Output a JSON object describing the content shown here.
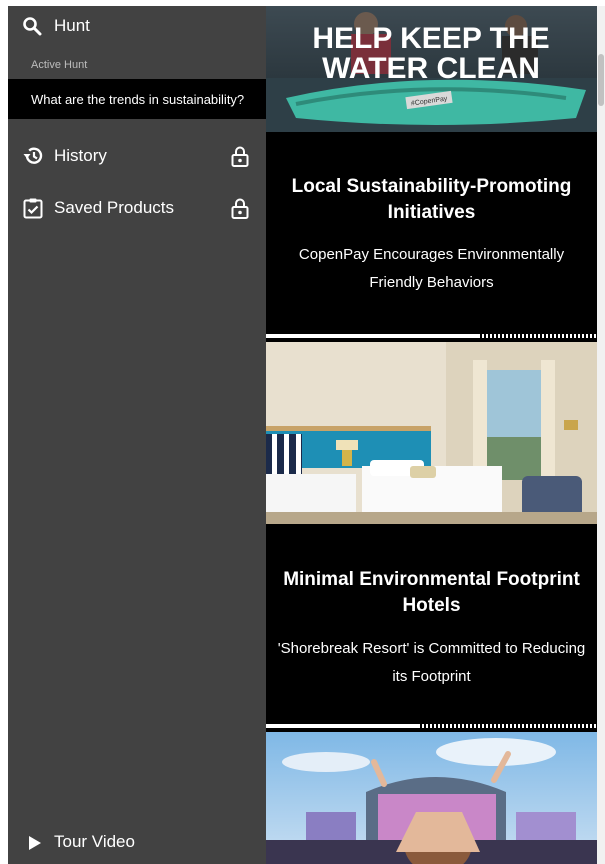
{
  "sidebar": {
    "hunt_label": "Hunt",
    "active_hunt_heading": "Active Hunt",
    "active_hunt_query": "What are the trends in sustainability?",
    "history_label": "History",
    "saved_products_label": "Saved Products",
    "tour_video_label": "Tour Video",
    "icons": {
      "hunt": "search-icon",
      "history": "history-icon",
      "saved_products": "clipboard-check-icon",
      "locked": "lock-icon",
      "tour_video": "play-icon"
    },
    "colors": {
      "background": "#424242",
      "active_item": "#000000",
      "text": "#ffffff",
      "muted": "#bdbdbd"
    }
  },
  "feed": {
    "cards": [
      {
        "image_caption": "HELP KEEP THE WATER CLEAN",
        "image_tag": "#CopenPay",
        "title": "Local Sustainability-Promoting Initiatives",
        "subtitle": "CopenPay Encourages Environmentally Friendly Behaviors",
        "progress": 0.64
      },
      {
        "title": "Minimal Environmental Footprint Hotels",
        "subtitle": "'Shorebreak Resort' is Committed to Reducing its Footprint",
        "progress": 0.46
      },
      {
        "title": "",
        "subtitle": ""
      }
    ]
  }
}
